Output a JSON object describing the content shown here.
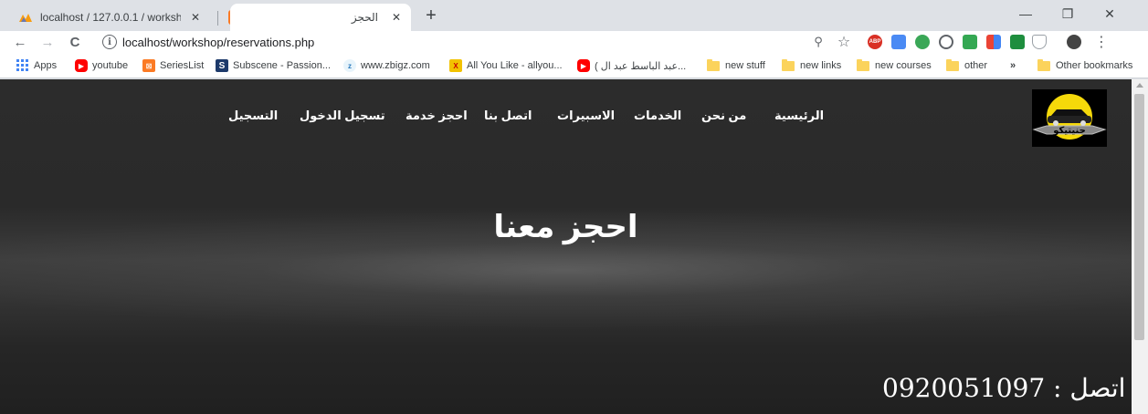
{
  "browser": {
    "tabs": [
      {
        "title": "localhost / 127.0.0.1 / workshop | ",
        "favicon": "phpmyadmin-icon",
        "active": false
      },
      {
        "title": "",
        "favicon": "xampp-icon",
        "active": false
      },
      {
        "title": "الحجز",
        "favicon": "",
        "active": true
      }
    ],
    "close_glyph": "✕",
    "new_tab_glyph": "+",
    "window_controls": {
      "minimize": "—",
      "restore": "❐",
      "close": "✕"
    },
    "url": "localhost/workshop/reservations.php",
    "back_glyph": "←",
    "forward_glyph": "→",
    "reload_glyph": "C",
    "info_glyph": "i",
    "zoom_glyph": "⚲",
    "star_glyph": "☆",
    "menu_glyph": "⋮"
  },
  "bookmarks": [
    {
      "label": "Apps",
      "icon": "apps-grid-icon"
    },
    {
      "label": "youtube",
      "icon": "youtube-icon"
    },
    {
      "label": "SeriesList",
      "icon": "serieslist-icon"
    },
    {
      "label": "Subscene - Passion...",
      "icon": "subscene-icon"
    },
    {
      "label": "www.zbigz.com",
      "icon": "zbigz-icon"
    },
    {
      "label": "All You Like - allyou...",
      "icon": "allyoulike-icon"
    },
    {
      "label": "( عبد الباسط عبد ال...",
      "icon": "youtube-icon"
    },
    {
      "label": "new stuff",
      "icon": "folder-icon"
    },
    {
      "label": "new links",
      "icon": "folder-icon"
    },
    {
      "label": "new courses",
      "icon": "folder-icon"
    },
    {
      "label": "other",
      "icon": "folder-icon"
    },
    {
      "label": "»",
      "icon": ""
    },
    {
      "label": "Other bookmarks",
      "icon": "folder-icon"
    }
  ],
  "page": {
    "nav": [
      {
        "label": "الرئيسية"
      },
      {
        "label": "من نحن"
      },
      {
        "label": "الخدمات"
      },
      {
        "label": "الاسبيرات"
      },
      {
        "label": "اتصل بنا"
      },
      {
        "label": "احجز خدمة"
      },
      {
        "label": "تسجيل الدخول"
      },
      {
        "label": "التسجيل"
      }
    ],
    "headline": "احجز معنا",
    "contact": "اتصل : 0920051097",
    "logo_text": "جنيتيكو",
    "logo_color": "#f5d90a"
  }
}
